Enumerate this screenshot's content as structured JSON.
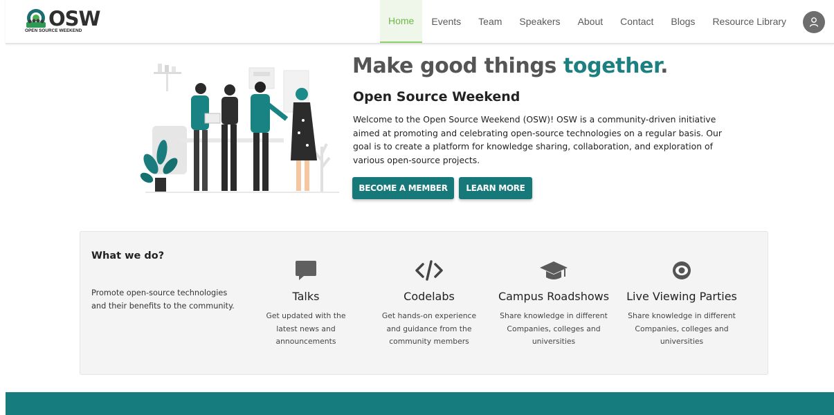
{
  "brand": {
    "logo_text": "OSW",
    "logo_subtext": "OPEN SOURCE WEEKEND"
  },
  "nav": {
    "items": [
      {
        "label": "Home",
        "active": true
      },
      {
        "label": "Events"
      },
      {
        "label": "Team"
      },
      {
        "label": "Speakers"
      },
      {
        "label": "About"
      },
      {
        "label": "Contact"
      },
      {
        "label": "Blogs"
      },
      {
        "label": "Resource Library"
      }
    ],
    "avatar_icon": "user-icon"
  },
  "hero": {
    "title_main": "Make good things ",
    "title_accent": "together",
    "title_end": ".",
    "subtitle": "Open Source Weekend",
    "description": "Welcome to the Open Source Weekend (OSW)! OSW is a community-driven initiative aimed at promoting and celebrating open-source technologies on a regular basis. Our goal is to create a platform for knowledge sharing, collaboration, and exploration of various open-source projects.",
    "btn_member": "BECOME A MEMBER",
    "btn_learn": "LEARN MORE"
  },
  "what_we_do": {
    "title": "What we do?",
    "description": "Promote open-source technologies and their benefits to the community.",
    "features": [
      {
        "icon": "chat-bubble-icon",
        "title": "Talks",
        "description": "Get updated with the latest news and announcements"
      },
      {
        "icon": "code-icon",
        "title": "Codelabs",
        "description": "Get hands-on experience and guidance from the community members"
      },
      {
        "icon": "graduation-cap-icon",
        "title": "Campus Roadshows",
        "description": "Share knowledge in different Companies, colleges and universities"
      },
      {
        "icon": "eye-icon",
        "title": "Live Viewing Parties",
        "description": "Share knowledge in different Companies, colleges and universities"
      }
    ]
  },
  "colors": {
    "brand_teal": "#17787a",
    "nav_active": "#6cb84a",
    "footer": "#167c7e"
  }
}
